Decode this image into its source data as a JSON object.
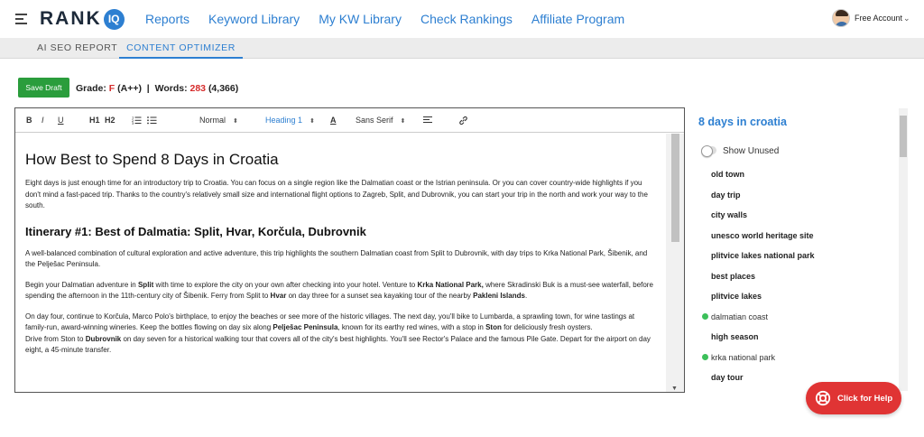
{
  "header": {
    "logo_text": "RANK",
    "logo_badge": "IQ",
    "nav": [
      "Reports",
      "Keyword Library",
      "My KW Library",
      "Check Rankings",
      "Affiliate Program"
    ],
    "account_label": "Free Account"
  },
  "subnav": {
    "tabs": [
      "AI SEO REPORT",
      "CONTENT OPTIMIZER"
    ],
    "active": "CONTENT OPTIMIZER"
  },
  "status": {
    "save_label": "Save Draft",
    "grade_prefix": "Grade: ",
    "grade": "F",
    "grade_target": "(A++)",
    "separator": "|",
    "words_prefix": "Words: ",
    "words": "283",
    "words_target": "(4,366)"
  },
  "editor_toolbar": {
    "bold": "B",
    "italic": "I",
    "underline": "U",
    "h1": "H1",
    "h2": "H2",
    "size": "Normal",
    "heading": "Heading 1",
    "color": "A",
    "font": "Sans Serif"
  },
  "document": {
    "title": "How Best to Spend 8 Days in Croatia",
    "intro": "Eight days is just enough time for an introductory trip to Croatia. You can focus on a single region like the Dalmatian coast or the Istrian peninsula. Or you can cover country-wide highlights if you don't mind a fast-paced trip. Thanks to the country's relatively small size and international flight options to Zagreb, Split, and Dubrovnik, you can start your trip in the north and work your way to the south.",
    "section_heading": "Itinerary #1: Best of Dalmatia: Split, Hvar, Korčula, Dubrovnik",
    "section_intro": "A well-balanced combination of cultural exploration and active adventure, this trip highlights the southern Dalmatian coast from Split to Dubrovnik, with day trips to Krka National Park, Šibenik, and the Pelješac Peninsula.",
    "p1": {
      "a": "Begin your Dalmatian adventure in ",
      "b1": "Split",
      "c": " with time to explore the city on your own after checking into your hotel. Venture to ",
      "b2": "Krka National Park,",
      "d": " where Skradinski Buk is a must-see waterfall, before spending the afternoon in the 11th-century city of Šibenik. Ferry from Split to ",
      "b3": "Hvar",
      "e": " on day three for a sunset sea kayaking tour of the nearby ",
      "b4": "Pakleni Islands",
      "f": "."
    },
    "p2": {
      "a": "On day four, continue to Korčula, Marco Polo's birthplace, to enjoy the beaches or see more of the historic villages. The next day, you'll bike to Lumbarda, a sprawling town, for wine tastings at family-run, award-winning wineries. Keep the bottles flowing on day six along ",
      "b1": "Pelješac Peninsula",
      "c": ", known for its earthy red wines, with a stop in ",
      "b2": "Ston",
      "d": " for deliciously fresh oysters."
    },
    "p3": {
      "a": "Drive from Ston to ",
      "b1": "Dubrovnik",
      "c": " on day seven for a historical walking tour that covers all of the city's best highlights. You'll see Rector's Palace and the famous Pile Gate. Depart for the airport on day eight, a 45-minute transfer."
    }
  },
  "keywords_panel": {
    "title": "8 days in croatia",
    "toggle_label": "Show Unused",
    "keywords": [
      {
        "text": "old town",
        "used": false
      },
      {
        "text": "day trip",
        "used": false
      },
      {
        "text": "city walls",
        "used": false
      },
      {
        "text": "unesco world heritage site",
        "used": false
      },
      {
        "text": "plitvice lakes national park",
        "used": false
      },
      {
        "text": "best places",
        "used": false
      },
      {
        "text": "plitvice lakes",
        "used": false
      },
      {
        "text": "dalmatian coast",
        "used": true
      },
      {
        "text": "high season",
        "used": false
      },
      {
        "text": "krka national park",
        "used": true
      },
      {
        "text": "day tour",
        "used": false
      }
    ]
  },
  "help": {
    "label": "Click for Help"
  },
  "colors": {
    "accent": "#2d7fd1",
    "save": "#2a9d3c",
    "grade_red": "#d62b2b",
    "help": "#e03434",
    "used_dot": "#3cc05a"
  }
}
